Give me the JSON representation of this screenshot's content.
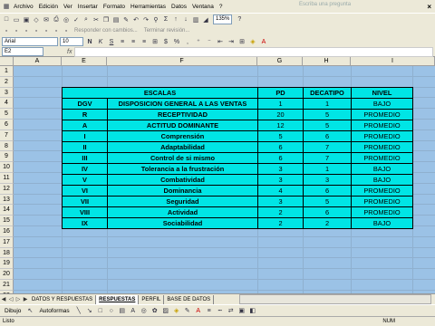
{
  "menubar": {
    "items": [
      "Archivo",
      "Edición",
      "Ver",
      "Insertar",
      "Formato",
      "Herramientas",
      "Datos",
      "Ventana",
      "?"
    ],
    "help_hint": "Escriba una pregunta",
    "close": "×"
  },
  "toolbar": {
    "zoom": "135%",
    "hint1": "Responder con cambios...",
    "hint2": "Terminar revisión..."
  },
  "format_bar": {
    "font": "Arial",
    "size": "10"
  },
  "formula_bar": {
    "name_box": "E2",
    "fx": "fx"
  },
  "columns": [
    "A",
    "E",
    "F",
    "G",
    "H",
    "I"
  ],
  "rows": [
    "1",
    "2",
    "3",
    "4",
    "5",
    "6",
    "7",
    "8",
    "9",
    "10",
    "11",
    "12",
    "13",
    "14",
    "15",
    "16",
    "17",
    "18",
    "19",
    "20",
    "21",
    "22"
  ],
  "table": {
    "headers": [
      "ESCALAS",
      "",
      "PD",
      "DECATIPO",
      "NIVEL"
    ],
    "rows": [
      [
        "DGV",
        "DISPOSICION GENERAL A LAS VENTAS",
        "1",
        "1",
        "BAJO"
      ],
      [
        "R",
        "RECEPTIVIDAD",
        "20",
        "5",
        "PROMEDIO"
      ],
      [
        "A",
        "ACTITUD DOMINANTE",
        "12",
        "5",
        "PROMEDIO"
      ],
      [
        "I",
        "Comprensión",
        "5",
        "6",
        "PROMEDIO"
      ],
      [
        "II",
        "Adaptabilidad",
        "6",
        "7",
        "PROMEDIO"
      ],
      [
        "III",
        "Control de si mismo",
        "6",
        "7",
        "PROMEDIO"
      ],
      [
        "IV",
        "Tolerancia a la frustración",
        "3",
        "1",
        "BAJO"
      ],
      [
        "V",
        "Combatividad",
        "3",
        "3",
        "BAJO"
      ],
      [
        "VI",
        "Dominancia",
        "4",
        "6",
        "PROMEDIO"
      ],
      [
        "VII",
        "Seguridad",
        "3",
        "5",
        "PROMEDIO"
      ],
      [
        "VIII",
        "Actividad",
        "2",
        "6",
        "PROMEDIO"
      ],
      [
        "IX",
        "Sociabilidad",
        "2",
        "2",
        "BAJO"
      ]
    ]
  },
  "sheet_tabs": [
    "DATOS Y RESPUESTAS",
    "RESPUESTAS",
    "PERFIL",
    "BASE DE DATOS"
  ],
  "active_tab": "RESPUESTAS",
  "draw_bar": {
    "dibujo": "Dibujo",
    "autoformas": "Autoformas"
  },
  "status": {
    "left": "Listo",
    "num": "NUM"
  }
}
